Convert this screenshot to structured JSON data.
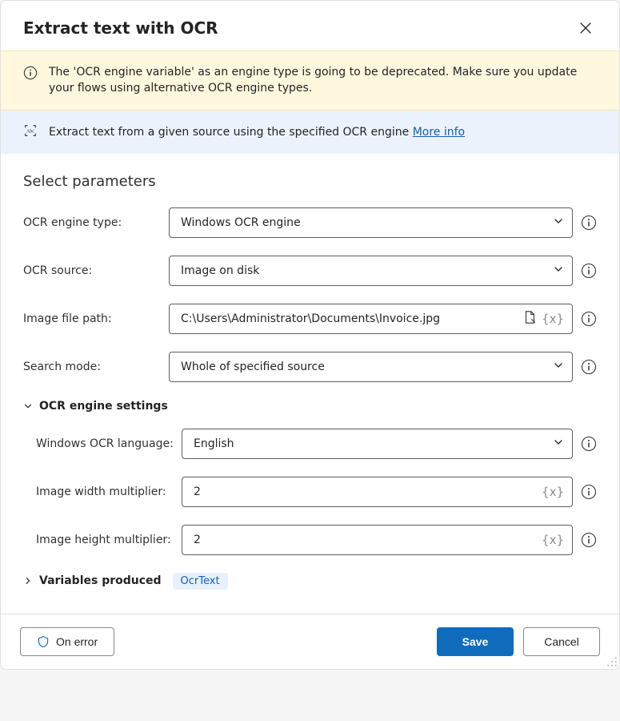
{
  "header": {
    "title": "Extract text with OCR"
  },
  "warning": {
    "text": "The 'OCR engine variable' as an engine type is going to be deprecated.  Make sure you update your flows using alternative OCR engine types."
  },
  "info": {
    "text": "Extract text from a given source using the specified OCR engine ",
    "more_link": "More info"
  },
  "section_title": "Select parameters",
  "fields": {
    "engine_type": {
      "label": "OCR engine type:",
      "value": "Windows OCR engine"
    },
    "ocr_source": {
      "label": "OCR source:",
      "value": "Image on disk"
    },
    "image_path": {
      "label": "Image file path:",
      "value": "C:\\Users\\Administrator\\Documents\\Invoice.jpg"
    },
    "search_mode": {
      "label": "Search mode:",
      "value": "Whole of specified source"
    }
  },
  "engine_settings": {
    "header": "OCR engine settings",
    "language": {
      "label": "Windows OCR language:",
      "value": "English"
    },
    "width_mult": {
      "label": "Image width multiplier:",
      "value": "2"
    },
    "height_mult": {
      "label": "Image height multiplier:",
      "value": "2"
    }
  },
  "variables_produced": {
    "header": "Variables produced",
    "chip": "OcrText"
  },
  "footer": {
    "on_error": "On error",
    "save": "Save",
    "cancel": "Cancel"
  }
}
